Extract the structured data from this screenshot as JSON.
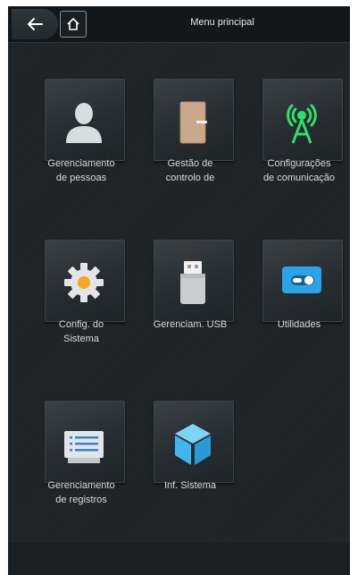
{
  "header": {
    "title": "Menu principal",
    "back_icon": "arrow-left-icon",
    "home_icon": "home-icon"
  },
  "tiles": [
    {
      "label": "Gerenciamento\nde pessoas",
      "icon": "person-icon"
    },
    {
      "label": "Gestão de\ncontrolo de",
      "icon": "door-icon"
    },
    {
      "label": "Configurações\nde comunicação",
      "icon": "antenna-icon"
    },
    {
      "label": "Config. do\nSistema",
      "icon": "gear-icon"
    },
    {
      "label": "Gerenciam. USB",
      "icon": "usb-drive-icon"
    },
    {
      "label": "Utilidades",
      "icon": "toggle-icon"
    },
    {
      "label": "Gerenciamento\nde registros",
      "icon": "records-icon"
    },
    {
      "label": "Inf. Sistema",
      "icon": "cube-icon"
    }
  ],
  "colors": {
    "background": "#1f2326",
    "antenna_green": "#2ee06a",
    "gear_orange": "#f5a623",
    "toggle_blue": "#2aa3e8",
    "cube_blue": "#3fb6ef",
    "door_tan": "#c9a98a"
  }
}
